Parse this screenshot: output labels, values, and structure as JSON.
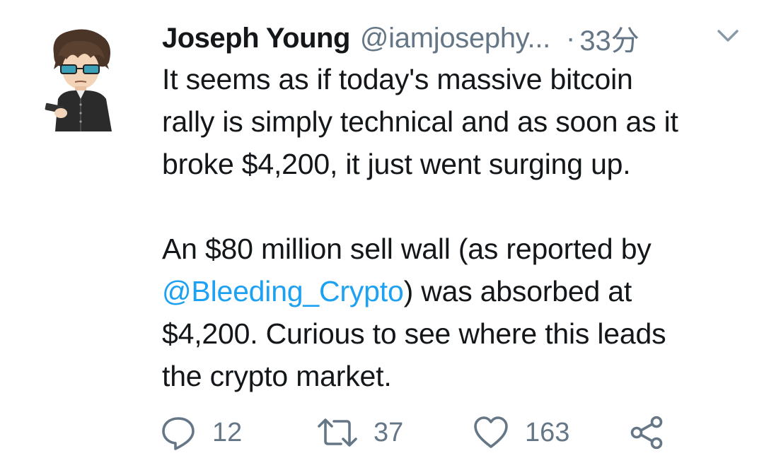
{
  "tweet": {
    "author_name": "Joseph Young",
    "author_handle": "@iamjosephy...",
    "separator": "·",
    "time": "33分",
    "line1": "It seems as if today's massive bitcoin",
    "line2": "rally is simply technical and as soon as it",
    "line3": "broke $4,200, it just went surging up.",
    "para2_line1": "An $80 million sell wall (as reported by",
    "mention": "@Bleeding_Crypto",
    "para2_line2_after": ") was absorbed at",
    "para2_line3": "$4,200. Curious to see where this leads",
    "para2_line4": "the crypto market.",
    "replies": "12",
    "retweets": "37",
    "likes": "163"
  },
  "colors": {
    "text": "#14171a",
    "muted": "#657786",
    "link": "#1da1f2"
  },
  "icons": {
    "menu": "chevron-down-icon",
    "reply": "reply-icon",
    "retweet": "retweet-icon",
    "like": "heart-icon",
    "share": "share-icon"
  }
}
